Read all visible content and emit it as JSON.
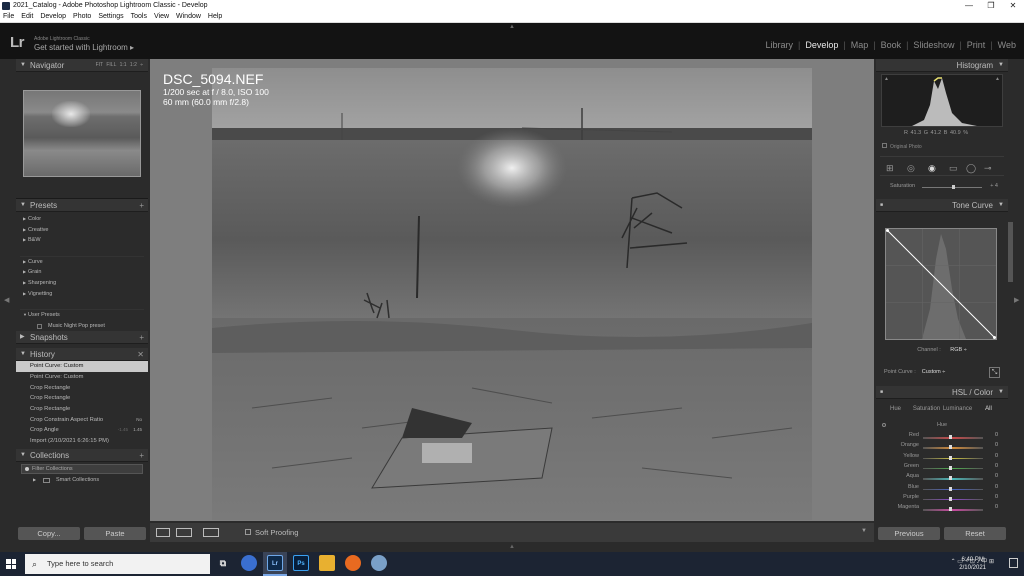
{
  "window": {
    "title": "2021_Catalog - Adobe Photoshop Lightroom Classic - Develop",
    "controls": [
      "—",
      "❐",
      "✕"
    ]
  },
  "menu": [
    "File",
    "Edit",
    "Develop",
    "Photo",
    "Settings",
    "Tools",
    "View",
    "Window",
    "Help"
  ],
  "identity": {
    "logo": "Lr",
    "small": "Adobe Lightroom Classic",
    "main": "Get started with Lightroom ▸"
  },
  "modules": [
    {
      "label": "Library",
      "active": false
    },
    {
      "label": "Develop",
      "active": true
    },
    {
      "label": "Map",
      "active": false
    },
    {
      "label": "Book",
      "active": false
    },
    {
      "label": "Slideshow",
      "active": false
    },
    {
      "label": "Print",
      "active": false
    },
    {
      "label": "Web",
      "active": false
    }
  ],
  "left_panel": {
    "navigator": {
      "title": "Navigator",
      "zoom": "FIT  FILL  1:1  1:2 ÷"
    },
    "presets": {
      "title": "Presets",
      "groups": [
        "Color",
        "Creative",
        "B&W",
        "Curve",
        "Grain",
        "Sharpening",
        "Vignetting"
      ],
      "user_group": "User Presets",
      "user_item": "Music Night Pop preset"
    },
    "snapshots": {
      "title": "Snapshots"
    },
    "history": {
      "title": "History",
      "items": [
        {
          "label": "Point Curve: Custom",
          "v1": "",
          "v2": ""
        },
        {
          "label": "Point Curve: Custom",
          "v1": "",
          "v2": ""
        },
        {
          "label": "Crop Rectangle",
          "v1": "",
          "v2": ""
        },
        {
          "label": "Crop Rectangle",
          "v1": "",
          "v2": ""
        },
        {
          "label": "Crop Rectangle",
          "v1": "",
          "v2": ""
        },
        {
          "label": "Crop Constrain Aspect Ratio",
          "v1": "",
          "v2": "No"
        },
        {
          "label": "Crop Angle",
          "v1": "-1.45",
          "v2": "1.45"
        },
        {
          "label": "Import (2/10/2021 6:26:15 PM)",
          "v1": "",
          "v2": ""
        }
      ]
    },
    "collections": {
      "title": "Collections",
      "filter": "Filter Collections",
      "smart": "Smart Collections"
    },
    "buttons": {
      "copy": "Copy...",
      "paste": "Paste"
    }
  },
  "photo_info": {
    "filename": "DSC_5094.NEF",
    "exposure": "1/200 sec at f / 8.0, ISO 100",
    "lens": "60 mm (60.0 mm f/2.8)"
  },
  "toolbar": {
    "soft_proofing": "Soft Proofing"
  },
  "right_panel": {
    "histogram": {
      "title": "Histogram",
      "readout": "R  41.3  G  41.2  B  40.9  %",
      "original_photo": "Original Photo"
    },
    "saturation": {
      "label": "Saturation",
      "value": "+ 4"
    },
    "tone_curve": {
      "title": "Tone Curve",
      "channel_label": "Channel :",
      "channel_value": "RGB ÷",
      "point_curve_label": "Point Curve :",
      "point_curve_value": "Custom ÷"
    },
    "hsl": {
      "title": "HSL / Color",
      "tabs": [
        "Hue",
        "Saturation",
        "Luminance",
        "All"
      ],
      "active_tab": "All",
      "section": "Hue",
      "rows": [
        {
          "name": "Red",
          "value": "0",
          "color": "#c84a4a"
        },
        {
          "name": "Orange",
          "value": "0",
          "color": "#d08a3a"
        },
        {
          "name": "Yellow",
          "value": "0",
          "color": "#c8c040"
        },
        {
          "name": "Green",
          "value": "0",
          "color": "#4fae4f"
        },
        {
          "name": "Aqua",
          "value": "0",
          "color": "#4ab8b8"
        },
        {
          "name": "Blue",
          "value": "0",
          "color": "#4a64c8"
        },
        {
          "name": "Purple",
          "value": "0",
          "color": "#8a4ac8"
        },
        {
          "name": "Magenta",
          "value": "0",
          "color": "#c84aa0"
        }
      ]
    },
    "buttons": {
      "previous": "Previous",
      "reset": "Reset"
    }
  },
  "taskbar": {
    "search_placeholder": "Type here to search",
    "apps": [
      "task-view",
      "chrome",
      "lightroom",
      "photoshop",
      "file-explorer",
      "firefox",
      "other"
    ],
    "tray_lang": "中",
    "time": "6:40 PM",
    "date": "2/10/2021"
  }
}
